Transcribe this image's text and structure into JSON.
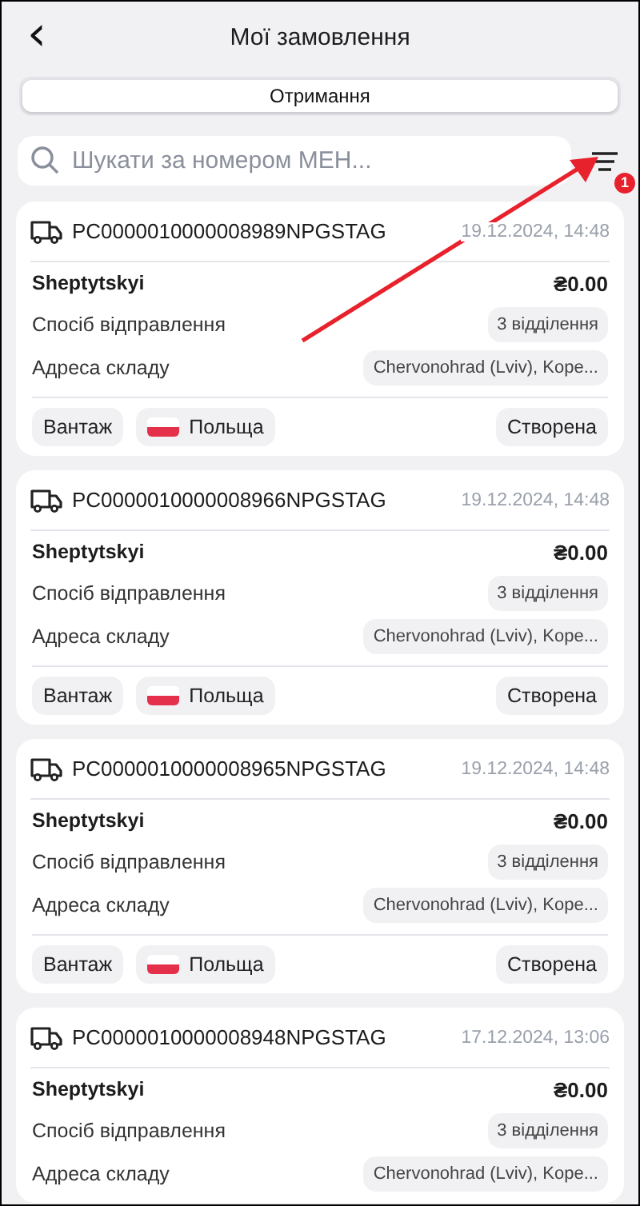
{
  "header": {
    "back_icon": "‹",
    "title": "Мої замовлення"
  },
  "segments": [
    {
      "label": "Отримання",
      "selected": true
    }
  ],
  "search": {
    "placeholder": "Шукати за номером МЕН..."
  },
  "filter": {
    "badge": "1"
  },
  "orders": [
    {
      "number": "PC0000010000008989NPGSTAG",
      "date": "19.12.2024, 14:48",
      "name": "Sheptytskyi",
      "amount": "₴0.00",
      "rows": [
        {
          "label": "Спосіб відправлення",
          "value": "3 відділення"
        },
        {
          "label": "Адреса складу",
          "value": "Chervonohrad (Lviv), Kope..."
        }
      ],
      "footer": {
        "type": "Вантаж",
        "country": "Польща",
        "status": "Створена"
      }
    },
    {
      "number": "PC0000010000008966NPGSTAG",
      "date": "19.12.2024, 14:48",
      "name": "Sheptytskyi",
      "amount": "₴0.00",
      "rows": [
        {
          "label": "Спосіб відправлення",
          "value": "3 відділення"
        },
        {
          "label": "Адреса складу",
          "value": "Chervonohrad (Lviv), Kope..."
        }
      ],
      "footer": {
        "type": "Вантаж",
        "country": "Польща",
        "status": "Створена"
      }
    },
    {
      "number": "PC0000010000008965NPGSTAG",
      "date": "19.12.2024, 14:48",
      "name": "Sheptytskyi",
      "amount": "₴0.00",
      "rows": [
        {
          "label": "Спосіб відправлення",
          "value": "3 відділення"
        },
        {
          "label": "Адреса складу",
          "value": "Chervonohrad (Lviv), Kope..."
        }
      ],
      "footer": {
        "type": "Вантаж",
        "country": "Польща",
        "status": "Створена"
      }
    },
    {
      "number": "PC0000010000008948NPGSTAG",
      "date": "17.12.2024, 13:06",
      "name": "Sheptytskyi",
      "amount": "₴0.00",
      "rows": [
        {
          "label": "Спосіб відправлення",
          "value": "3 відділення"
        },
        {
          "label": "Адреса складу",
          "value": "Chervonohrad (Lviv), Kope..."
        }
      ]
    }
  ]
}
